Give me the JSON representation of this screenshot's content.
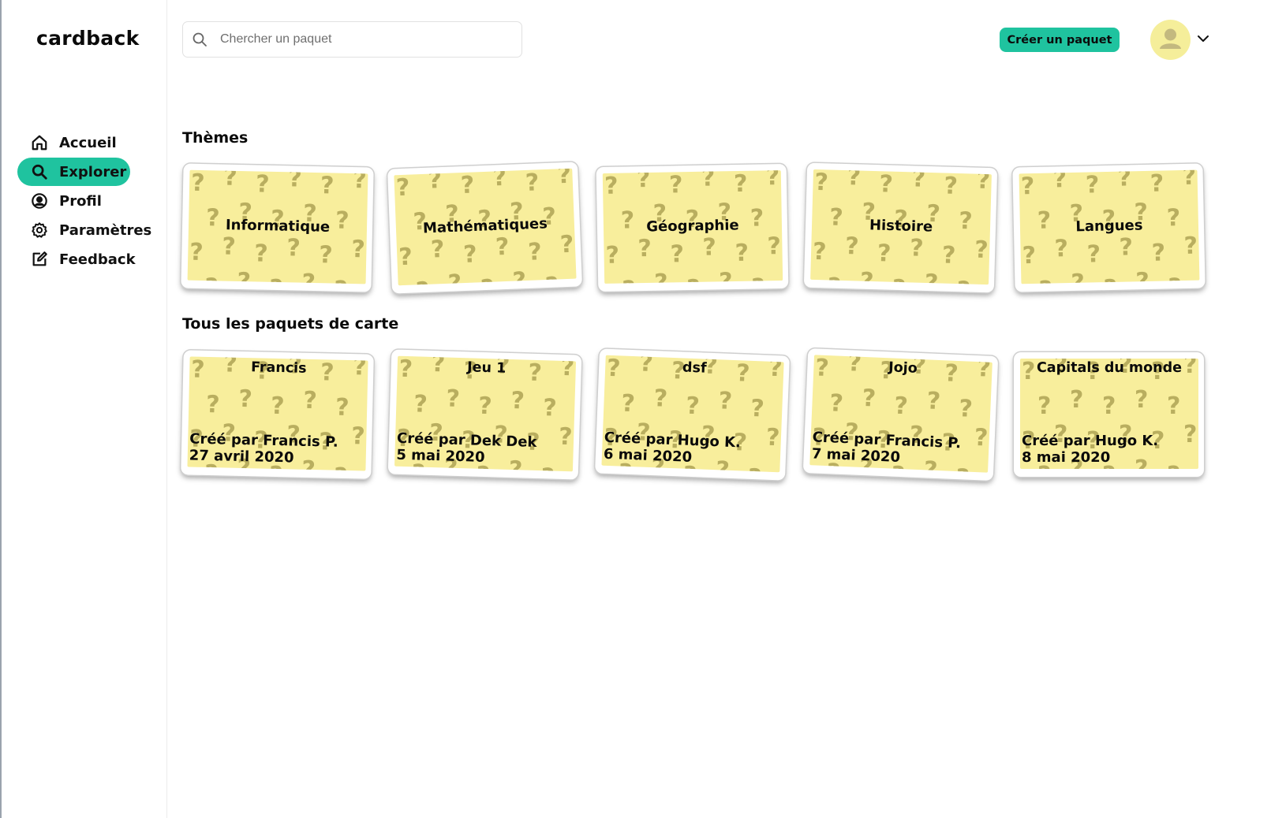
{
  "app": {
    "logo": "cardback"
  },
  "sidebar": {
    "items": [
      {
        "label": "Accueil",
        "icon": "home-icon",
        "active": false
      },
      {
        "label": "Explorer",
        "icon": "search-icon",
        "active": true
      },
      {
        "label": "Profil",
        "icon": "user-circle-icon",
        "active": false
      },
      {
        "label": "Paramètres",
        "icon": "gear-icon",
        "active": false
      },
      {
        "label": "Feedback",
        "icon": "edit-icon",
        "active": false
      }
    ]
  },
  "header": {
    "search_placeholder": "Chercher un paquet",
    "search_value": "",
    "create_label": "Créer un paquet"
  },
  "themes": {
    "title": "Thèmes",
    "items": [
      "Informatique",
      "Mathématiques",
      "Géographie",
      "Histoire",
      "Langues"
    ]
  },
  "decks": {
    "title": "Tous les paquets de carte",
    "items": [
      {
        "title": "Francis",
        "author": "Créé par Francis P.",
        "date": "27 avril 2020"
      },
      {
        "title": "Jeu 1",
        "author": "Créé par Dek Dek",
        "date": "5 mai 2020"
      },
      {
        "title": "dsf",
        "author": "Créé par Hugo K.",
        "date": "6 mai 2020"
      },
      {
        "title": "Jojo",
        "author": "Créé par Francis P.",
        "date": "7 mai 2020"
      },
      {
        "title": "Capitals du monde",
        "author": "Créé par Hugo K.",
        "date": "8 mai 2020"
      }
    ]
  },
  "colors": {
    "accent": "#1fc39f",
    "card_face": "#f8ee9c",
    "question_mark": "#b9ae5f",
    "avatar_bg": "#f5ee9a",
    "avatar_fg": "#c3b97f"
  }
}
